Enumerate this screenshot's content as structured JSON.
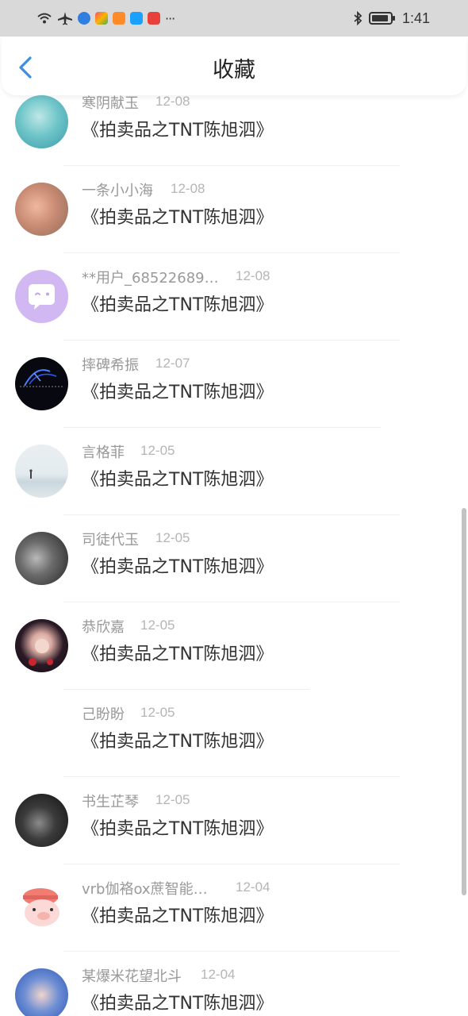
{
  "status_bar": {
    "time": "1:41",
    "more": "···"
  },
  "header": {
    "title": "收藏",
    "back_icon": "chevron-left-icon"
  },
  "colors": {
    "accent": "#3a8ee6",
    "status_bar_bg": "#d9d9d9",
    "meta_text": "#999999",
    "title_text": "#333333"
  },
  "items": [
    {
      "user": "寒阴献玉",
      "date": "12-08",
      "title": "《拍卖品之TNT陈旭泗》"
    },
    {
      "user": "一条小小海",
      "date": "12-08",
      "title": "《拍卖品之TNT陈旭泗》"
    },
    {
      "user": "**用户_68522689…",
      "date": "12-08",
      "title": "《拍卖品之TNT陈旭泗》"
    },
    {
      "user": "摔碑希振",
      "date": "12-07",
      "title": "《拍卖品之TNT陈旭泗》"
    },
    {
      "user": "言格菲",
      "date": "12-05",
      "title": "《拍卖品之TNT陈旭泗》"
    },
    {
      "user": "司徒代玉",
      "date": "12-05",
      "title": "《拍卖品之TNT陈旭泗》"
    },
    {
      "user": "恭欣嘉",
      "date": "12-05",
      "title": "《拍卖品之TNT陈旭泗》"
    },
    {
      "user": "己盼盼",
      "date": "12-05",
      "title": "《拍卖品之TNT陈旭泗》"
    },
    {
      "user": "书生芷琴",
      "date": "12-05",
      "title": "《拍卖品之TNT陈旭泗》"
    },
    {
      "user": "vrb伽袼ox蔗智能…",
      "date": "12-04",
      "title": "《拍卖品之TNT陈旭泗》"
    },
    {
      "user": "某爆米花望北斗",
      "date": "12-04",
      "title": "《拍卖品之TNT陈旭泗》"
    }
  ]
}
